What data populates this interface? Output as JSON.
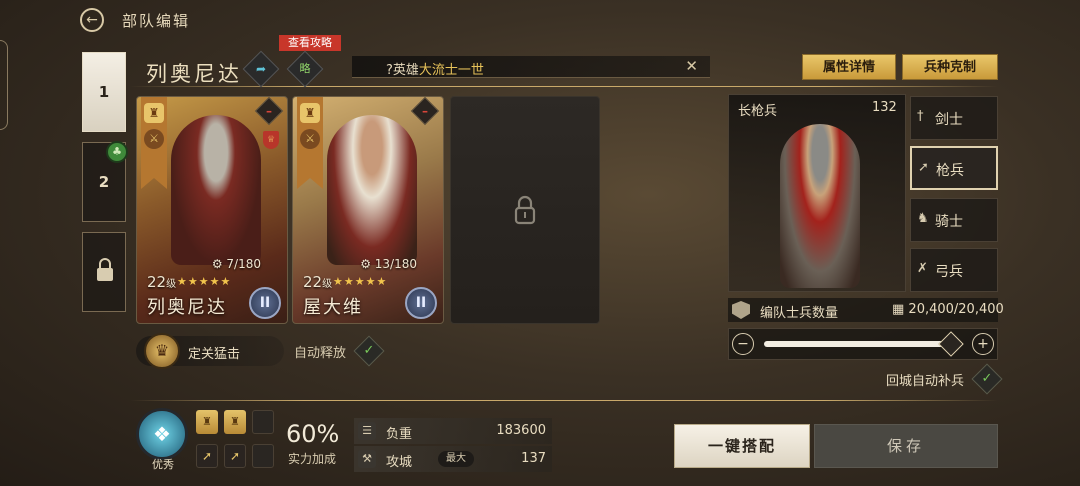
{
  "header": {
    "back_icon": "back-arrow-icon",
    "title": "部队编辑"
  },
  "teams": [
    {
      "label": "1",
      "active": true
    },
    {
      "label": "2",
      "active": false
    },
    {
      "label": "",
      "locked": true
    }
  ],
  "team2_badge_icon": "clover-icon",
  "commander": {
    "name": "列奥尼达",
    "strategy_tag": "查看攻略",
    "strategy_label": "略",
    "share_icon": "share-arrow-icon"
  },
  "hero_search": {
    "prefix": "?英雄",
    "highlight": "大流士一世"
  },
  "buttons": {
    "attributes": "属性详情",
    "counter": "兵种克制",
    "auto_equip": "一键搭配",
    "save": "保存"
  },
  "heroes": [
    {
      "name": "列奥尼达",
      "level": "22",
      "level_unit": "级",
      "stars": 5,
      "exp": "7/180",
      "rank": "II"
    },
    {
      "name": "屋大维",
      "level": "22",
      "level_unit": "级",
      "stars": 5,
      "exp": "13/180",
      "rank": "II"
    }
  ],
  "skill": {
    "name": "定关猛击",
    "auto_label": "自动释放",
    "auto_on": true
  },
  "unit": {
    "name": "长枪兵",
    "count": "132"
  },
  "unit_tabs": [
    {
      "label": "剑士",
      "icon": "sword-icon",
      "active": false
    },
    {
      "label": "枪兵",
      "icon": "spear-icon",
      "active": true
    },
    {
      "label": "骑士",
      "icon": "horse-icon",
      "active": false
    },
    {
      "label": "弓兵",
      "icon": "bow-icon",
      "active": false
    }
  ],
  "troops": {
    "label": "编队士兵数量",
    "value": "20,400/20,400",
    "fill": 1.0
  },
  "refill": {
    "label": "回城自动补兵",
    "on": true
  },
  "rating": {
    "label": "优秀"
  },
  "power": {
    "value": "60%",
    "label": "实力加成"
  },
  "stats": [
    {
      "name": "负重",
      "value": "183600"
    },
    {
      "name": "攻城",
      "badge": "最大",
      "value": "137"
    }
  ],
  "colors": {
    "gold": "#e4c36a",
    "accent_red": "#c8362a",
    "check_green": "#78c85a"
  }
}
